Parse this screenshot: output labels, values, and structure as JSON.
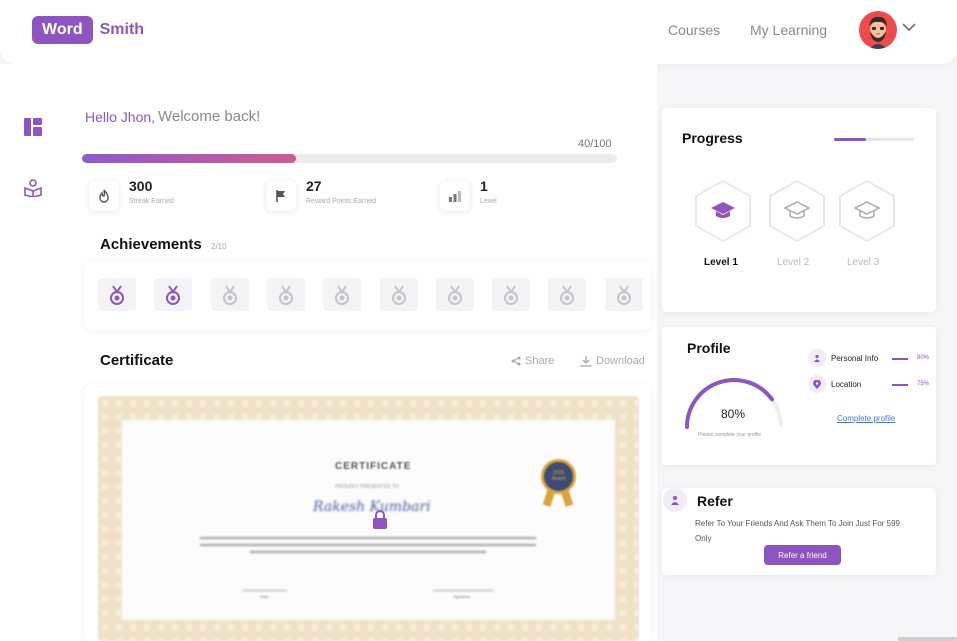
{
  "brand": {
    "box": "Word",
    "rest": "Smith",
    "color": "#8e55c1"
  },
  "nav": {
    "courses": "Courses",
    "my_learning": "My Learning"
  },
  "greeting": {
    "hello": "Hello Jhon,",
    "welcome": "Welcome back!"
  },
  "xp": {
    "label": "40/100",
    "current": 40,
    "max": 100
  },
  "stats": [
    {
      "value": "300",
      "label": "Streak Earned",
      "icon": "flame-icon"
    },
    {
      "value": "27",
      "label": "Reward Points Earned",
      "icon": "flag-icon"
    },
    {
      "value": "1",
      "label": "Level",
      "icon": "bar-chart-icon"
    }
  ],
  "achievements": {
    "title": "Achievements",
    "count": "2/10",
    "earned": 2,
    "total": 10
  },
  "certificate": {
    "title": "Certificate",
    "share": "Share",
    "download": "Download",
    "heading": "CERTIFICATE",
    "subheading": "PROUDLY PRESENTED TO",
    "name": "Rakesh Kumbari",
    "seal_line1": "2023",
    "seal_line2": "Award",
    "sig_left": "Date",
    "sig_right": "Signature"
  },
  "progress": {
    "title": "Progress",
    "fraction": 0.4,
    "levels": [
      {
        "label": "Level 1",
        "active": true
      },
      {
        "label": "Level 2",
        "active": false
      },
      {
        "label": "Level 3",
        "active": false
      }
    ]
  },
  "profile": {
    "title": "Profile",
    "percent": "80%",
    "percent_value": 80,
    "note": "Please complete your profile",
    "items": [
      {
        "label": "Personal Info",
        "pct": "80%",
        "icon": "person-icon"
      },
      {
        "label": "Location",
        "pct": "75%",
        "icon": "location-pin-icon"
      }
    ],
    "complete_link": "Complete profile"
  },
  "refer": {
    "title": "Refer",
    "text": "Refer To Your Friends And Ask Them To Join Just For 599 Only",
    "button": "Refer a friend"
  },
  "colors": {
    "accent": "#8e55c1",
    "pink": "#cf5c92",
    "avatar_bg": "#ef4b4b"
  }
}
